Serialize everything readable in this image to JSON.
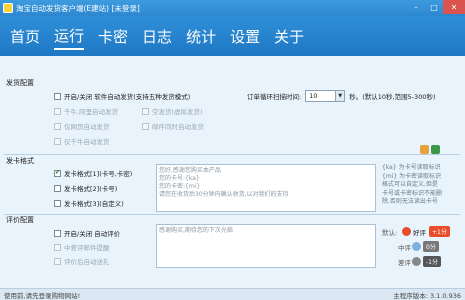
{
  "window": {
    "title": "淘宝自动发货客户端(E建站) [未登录]"
  },
  "nav": {
    "items": [
      "首页",
      "运行",
      "卡密",
      "日志",
      "统计",
      "设置",
      "关于"
    ],
    "active": 1
  },
  "shipping": {
    "label": "发货配置",
    "auto_ship": "开启/关闭 软件自动发货(支持五种发货模式)",
    "opt_qianniu": "千牛,阿里自动发货",
    "opt_empty": "空发货(虚拟发货)",
    "opt_samepage": "仅网页自动发货",
    "opt_email": "邮件同时自动发货",
    "opt_qianniu_only": "仅千牛自动发货",
    "scan_label": "订单循环扫描时间:",
    "scan_value": "10",
    "scan_unit": "秒。(默认10秒,范围5-300秒)"
  },
  "format": {
    "label": "发卡格式",
    "opt1": "发卡格式[1](卡号,卡密)",
    "opt2": "发卡格式[2](卡号)",
    "opt3": "发卡格式[3](自定义)",
    "template": "您好,感谢您购买本产品\n您的卡号:{ka}\n您的卡密:{mi}\n请您在收货后30分钟内确认收货,以对我们的支持",
    "hint": "{ka} 为卡号读取标识\n{mi} 为卡密读取标识\n格式可以自定义,但是\n卡号或卡密标识不能删\n除,否则无法读出卡号"
  },
  "review": {
    "label": "评价配置",
    "auto_review": "开启/关闭 自动评价",
    "opt_bad_email": "中差评邮件提醒",
    "opt_after": "评价后自动送礼",
    "template": "感谢购买,期待您的下次光临",
    "ratings": [
      {
        "label": "默认:",
        "name": "好评",
        "badge": "+1分",
        "color": "#e84c2b"
      },
      {
        "label": "中评",
        "name": "",
        "badge": "0分",
        "color": "#777777"
      },
      {
        "label": "差评",
        "name": "",
        "badge": "-1分",
        "color": "#555555"
      }
    ]
  },
  "status": {
    "left": "使用前,请先登录购物网站!",
    "right": "主程序版本: 3.1.0.936"
  }
}
